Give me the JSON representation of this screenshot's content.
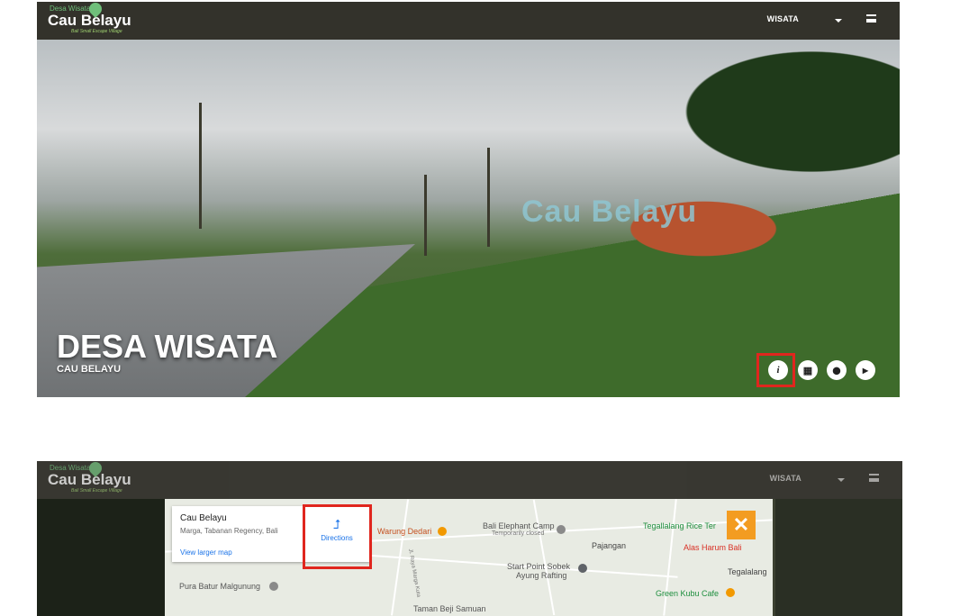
{
  "top": {
    "logo": {
      "small": "Desa Wisata",
      "big": "Cau Belayu",
      "tagline": "Bali Small Escape Village"
    },
    "nav_select": "WISATA",
    "hero": {
      "sign": "Cau Belayu",
      "title": "DESA WISATA",
      "subtitle": "CAU BELAYU"
    },
    "controls": [
      {
        "name": "info-icon",
        "glyph": "i"
      },
      {
        "name": "grid-icon",
        "glyph": "▦"
      },
      {
        "name": "location-pin-icon",
        "glyph": "⬤"
      },
      {
        "name": "play-video-icon",
        "glyph": "▶"
      }
    ]
  },
  "bottom": {
    "logo": {
      "small": "Desa Wisata",
      "big": "Cau Belayu",
      "tagline": "Bali Small Escape Village"
    },
    "nav_select": "WISATA",
    "map": {
      "place_title": "Cau Belayu",
      "place_address": "Marga, Tabanan Regency, Bali",
      "view_larger_map": "View larger map",
      "directions_label": "Directions",
      "labels": {
        "warung_dedari": "Warung Dedari",
        "bali_elephant_camp": "Bali Elephant Camp",
        "temporarily_closed": "Temporarily closed",
        "pajangan": "Pajangan",
        "tegallalang_rice": "Tegallalang Rice Ter",
        "alas_harum": "Alas Harum Bali",
        "tegalalang": "Tegalalang",
        "start_point": "Start Point Sobek",
        "ayung_rafting": "Ayung Rafting",
        "green_kubu": "Green Kubu Cafe",
        "pura_batur": "Pura Batur Malgunung",
        "taman_beji": "Taman Beji Samuan",
        "jl_raya": "Jl. Raya Marga Kuta"
      }
    },
    "close_label": "✕"
  },
  "colors": {
    "highlight": "#e0261e",
    "accent_orange": "#f39c21",
    "link_blue": "#1a73e8",
    "topbar": "#33322b"
  }
}
